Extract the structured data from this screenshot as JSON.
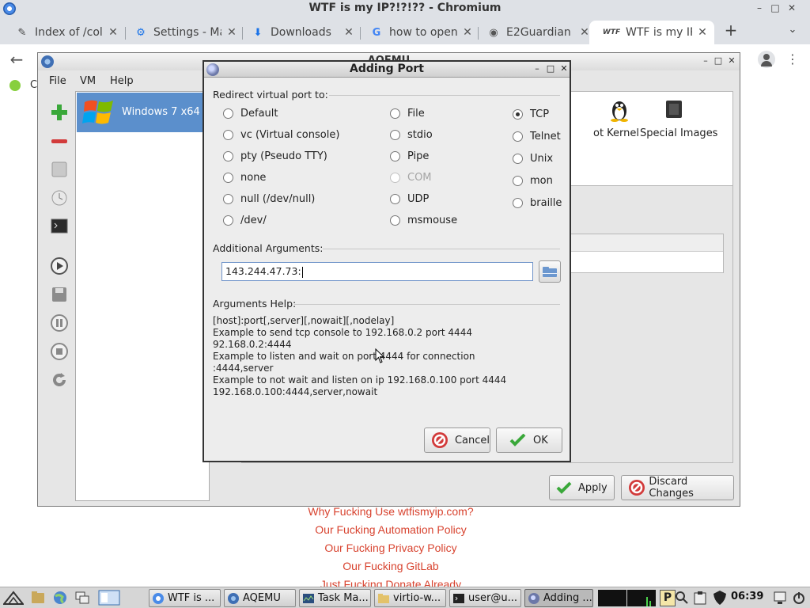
{
  "browser": {
    "window_title": "WTF is my IP?!?!?? - Chromium",
    "tabs": [
      {
        "label": "Index of /coll",
        "icon": "file-icon"
      },
      {
        "label": "Settings - Ma",
        "icon": "gear-icon"
      },
      {
        "label": "Downloads",
        "icon": "download-icon"
      },
      {
        "label": "how to open",
        "icon": "google-icon"
      },
      {
        "label": "E2Guardian -",
        "icon": "globe-icon"
      },
      {
        "label": "WTF is my IP",
        "icon": "wtf-icon",
        "active": true
      }
    ],
    "tab_icon_glyphs": {
      "file-icon": "✎",
      "gear-icon": "⚙",
      "download-icon": "⬇",
      "google-icon": "G",
      "globe-icon": "◉",
      "wtf-icon": "WTF"
    },
    "bookmark_label": "C",
    "page_links": [
      "Why Fucking Use wtfismyip.com?",
      "Our Fucking Automation Policy",
      "Our Fucking Privacy Policy",
      "Our Fucking GitLab",
      "Just Fucking Donate Already"
    ]
  },
  "aqemu": {
    "title": "AQEMU",
    "menu": [
      "File",
      "VM",
      "Help"
    ],
    "vm_name": "Windows 7 x64",
    "os_icons": [
      {
        "label": "ot Kernel"
      },
      {
        "label": "Special Images"
      }
    ],
    "apply_label": "Apply",
    "discard_label": "Discard Changes"
  },
  "dialog": {
    "title": "Adding Port",
    "redirect_label": "Redirect virtual port to:",
    "options": [
      {
        "label": "Default",
        "checked": false,
        "disabled": false
      },
      {
        "label": "vc (Virtual console)",
        "checked": false,
        "disabled": false
      },
      {
        "label": "pty (Pseudo TTY)",
        "checked": false,
        "disabled": false
      },
      {
        "label": "none",
        "checked": false,
        "disabled": false
      },
      {
        "label": "null (/dev/null)",
        "checked": false,
        "disabled": false
      },
      {
        "label": "/dev/",
        "checked": false,
        "disabled": false
      },
      {
        "label": "File",
        "checked": false,
        "disabled": false
      },
      {
        "label": "stdio",
        "checked": false,
        "disabled": false
      },
      {
        "label": "Pipe",
        "checked": false,
        "disabled": false
      },
      {
        "label": "COM",
        "checked": false,
        "disabled": true
      },
      {
        "label": "UDP",
        "checked": false,
        "disabled": false
      },
      {
        "label": "msmouse",
        "checked": false,
        "disabled": false
      },
      {
        "label": "TCP",
        "checked": true,
        "disabled": false
      },
      {
        "label": "Telnet",
        "checked": false,
        "disabled": false
      },
      {
        "label": "Unix",
        "checked": false,
        "disabled": false
      },
      {
        "label": "mon",
        "checked": false,
        "disabled": false
      },
      {
        "label": "braille",
        "checked": false,
        "disabled": false
      }
    ],
    "additional_args_label": "Additional Arguments:",
    "additional_args_value": "143.244.47.73:",
    "help_label": "Arguments Help:",
    "help_lines": [
      "[host]:port[,server][,nowait][,nodelay]",
      "Example to send tcp console to 192.168.0.2 port 4444",
      "92.168.0.2:4444",
      "Example to listen and wait on port 4444 for connection",
      ":4444,server",
      "Example to not wait and listen on ip 192.168.0.100 port 4444",
      "192.168.0.100:4444,server,nowait"
    ],
    "cancel_label": "Cancel",
    "ok_label": "OK"
  },
  "taskbar": {
    "tasks": [
      {
        "label": "WTF is ...",
        "active": false
      },
      {
        "label": "AQEMU",
        "active": false
      },
      {
        "label": "Task Ma...",
        "active": false
      },
      {
        "label": "virtio-w...",
        "active": false
      },
      {
        "label": "user@u...",
        "active": false
      },
      {
        "label": "Adding ...",
        "active": true
      }
    ],
    "clock": "06:39",
    "tray_letter": "P"
  }
}
